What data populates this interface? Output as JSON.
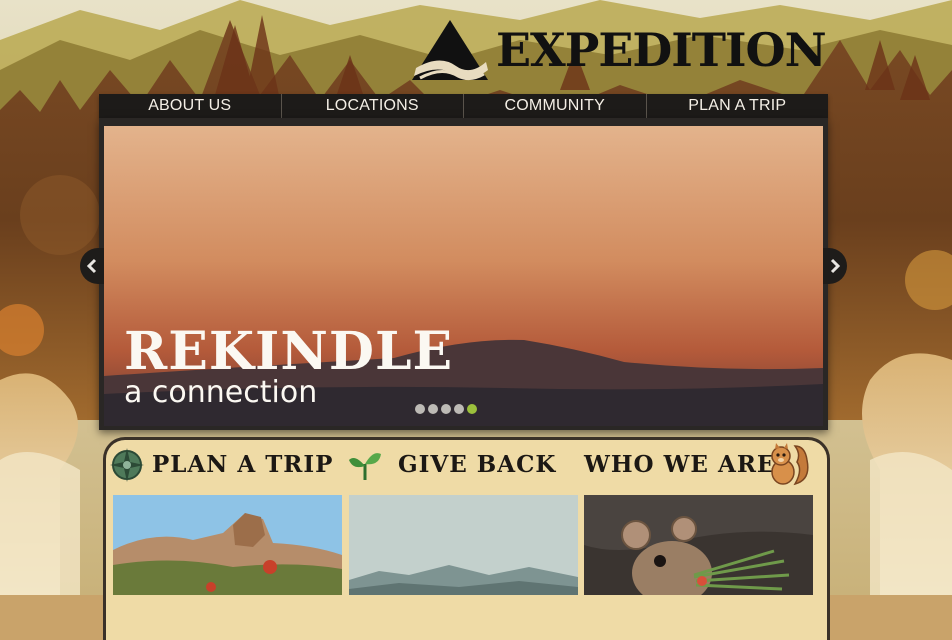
{
  "brand": {
    "name": "EXPEDITION",
    "logo_icon": "mountain-wave-logo"
  },
  "nav": {
    "items": [
      {
        "label": "ABOUT US"
      },
      {
        "label": "LOCATIONS"
      },
      {
        "label": "COMMUNITY"
      },
      {
        "label": "PLAN A TRIP"
      }
    ]
  },
  "hero": {
    "title": "REKINDLE",
    "subtitle": "a connection",
    "slide_count": 5,
    "active_slide": 5,
    "prev_icon": "chevron-left-icon",
    "next_icon": "chevron-right-icon"
  },
  "sections": [
    {
      "title": "PLAN A TRIP",
      "icon": "compass-icon"
    },
    {
      "title": "GIVE BACK",
      "icon": "sprout-icon"
    },
    {
      "title": "WHO WE ARE",
      "icon": "squirrel-icon"
    }
  ],
  "colors": {
    "accent": "#9cc03c",
    "nav_bg": "#1d1b19",
    "panel_bg": "#efdba6"
  }
}
